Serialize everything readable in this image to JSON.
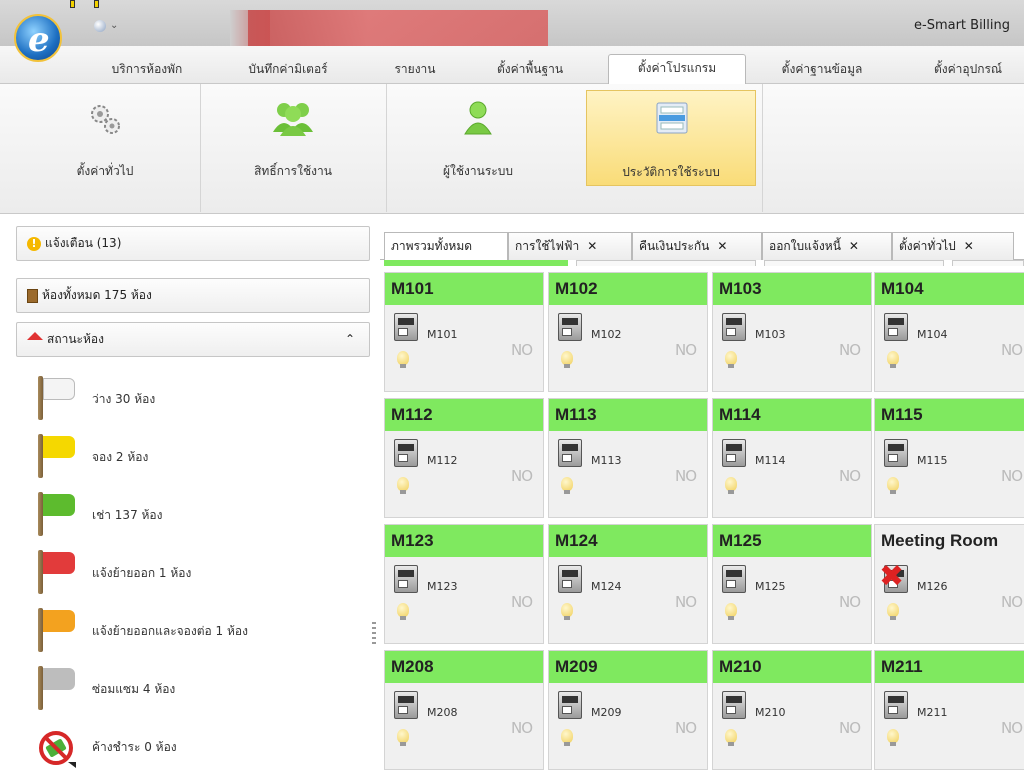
{
  "app": {
    "title": "e-Smart Billing"
  },
  "ribbon_tabs": [
    {
      "label": "บริการห้องพัก"
    },
    {
      "label": "บันทึกค่ามิเตอร์"
    },
    {
      "label": "รายงาน"
    },
    {
      "label": "ตั้งค่าพื้นฐาน"
    },
    {
      "label": "ตั้งค่าโปรแกรม",
      "selected": true
    },
    {
      "label": "ตั้งค่าฐานข้อมูล"
    },
    {
      "label": "ตั้งค่าอุปกรณ์"
    }
  ],
  "ribbon_buttons": [
    {
      "label": "ตั้งค่าทั่วไป",
      "icon": "gears-icon"
    },
    {
      "label": "สิทธิ์การใช้งาน",
      "icon": "users-icon"
    },
    {
      "label": "ผู้ใช้งานระบบ",
      "icon": "user-icon"
    },
    {
      "label": "ประวัติการใช้ระบบ",
      "icon": "history-list-icon",
      "selected": true
    }
  ],
  "sidebar": {
    "alerts": "แจ้งเตือน (13)",
    "all_rooms": "ห้องทั้งหมด 175 ห้อง",
    "room_status": "สถานะห้อง",
    "statuses": [
      {
        "label": "ว่าง 30 ห้อง",
        "color": "#f4f4f4"
      },
      {
        "label": "จอง 2 ห้อง",
        "color": "#f5d800"
      },
      {
        "label": "เช่า 137 ห้อง",
        "color": "#5dbb2e"
      },
      {
        "label": "แจ้งย้ายออก 1 ห้อง",
        "color": "#e23b3b"
      },
      {
        "label": "แจ้งย้ายออกและจองต่อ 1 ห้อง",
        "color": "#f3a21f"
      },
      {
        "label": "ซ่อมแซม 4 ห้อง",
        "color": "#bdbdbd"
      },
      {
        "label": "ค้างชำระ 0 ห้อง",
        "icon": "overdue-icon"
      }
    ]
  },
  "doc_tabs": [
    {
      "label": "ภาพรวมทั้งหมด",
      "selected": true,
      "closable": false
    },
    {
      "label": "การใช้ไฟฟ้า",
      "closable": true
    },
    {
      "label": "คืนเงินประกัน",
      "closable": true
    },
    {
      "label": "ออกใบแจ้งหนี้",
      "closable": true
    },
    {
      "label": "ตั้งค่าทั่วไป",
      "closable": true
    }
  ],
  "close_glyph": "✕",
  "no_image_text": "NO",
  "rooms": [
    {
      "name": "M101",
      "meter": "M101",
      "occupied": true
    },
    {
      "name": "M102",
      "meter": "M102",
      "occupied": true
    },
    {
      "name": "M103",
      "meter": "M103",
      "occupied": true
    },
    {
      "name": "M104",
      "meter": "M104",
      "occupied": true
    },
    {
      "name": "M112",
      "meter": "M112",
      "occupied": true
    },
    {
      "name": "M113",
      "meter": "M113",
      "occupied": true
    },
    {
      "name": "M114",
      "meter": "M114",
      "occupied": true
    },
    {
      "name": "M115",
      "meter": "M115",
      "occupied": true
    },
    {
      "name": "M123",
      "meter": "M123",
      "occupied": true
    },
    {
      "name": "M124",
      "meter": "M124",
      "occupied": true
    },
    {
      "name": "M125",
      "meter": "M125",
      "occupied": true
    },
    {
      "name": "Meeting Room",
      "meter": "M126",
      "occupied": false,
      "meter_disabled": true
    },
    {
      "name": "M208",
      "meter": "M208",
      "occupied": true
    },
    {
      "name": "M209",
      "meter": "M209",
      "occupied": true
    },
    {
      "name": "M210",
      "meter": "M210",
      "occupied": true
    },
    {
      "name": "M211",
      "meter": "M211",
      "occupied": true
    }
  ],
  "colors": {
    "occupied": "#7fe95f",
    "accent_ribbon": "#f9dc78"
  }
}
